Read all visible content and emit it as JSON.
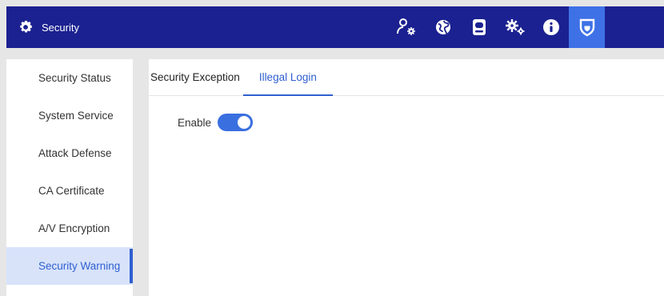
{
  "header": {
    "title": "Security",
    "icons": [
      "user-settings-icon",
      "network-globe-icon",
      "storage-drive-icon",
      "system-settings-icon",
      "info-icon",
      "shield-icon"
    ],
    "active_icon": "shield-icon"
  },
  "sidebar": {
    "items": [
      {
        "label": "Security Status"
      },
      {
        "label": "System Service"
      },
      {
        "label": "Attack Defense"
      },
      {
        "label": "CA Certificate"
      },
      {
        "label": "A/V Encryption"
      },
      {
        "label": "Security Warning"
      }
    ],
    "active_index": 5
  },
  "tabs": [
    {
      "label": "Security Exception"
    },
    {
      "label": "Illegal Login"
    }
  ],
  "active_tab": 1,
  "form": {
    "enable_label": "Enable",
    "enable_value": true
  },
  "colors": {
    "header_bg": "#1b2190",
    "accent": "#2f5fd0",
    "active_icon_bg": "#3f71e6",
    "active_item_bg": "#d8e3fa"
  }
}
